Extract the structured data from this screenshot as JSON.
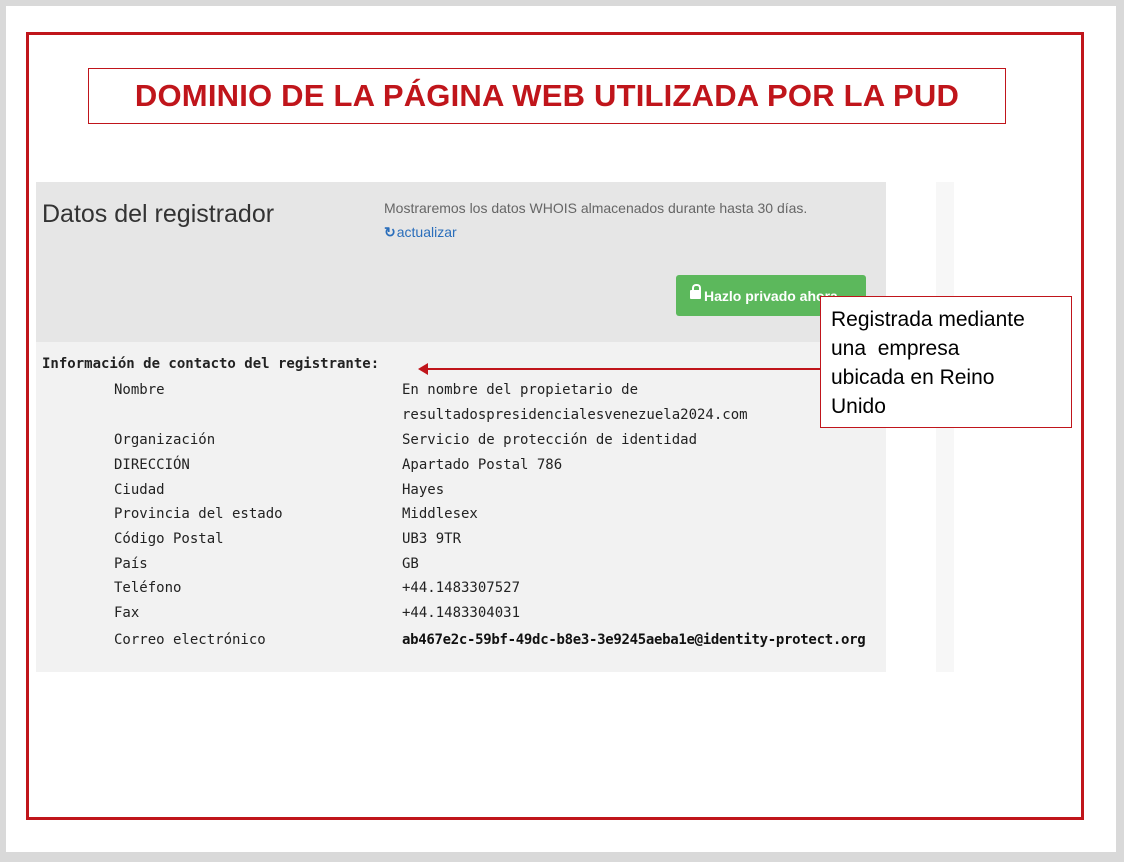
{
  "title": "DOMINIO DE LA PÁGINA WEB UTILIZADA POR LA PUD",
  "header": {
    "heading": "Datos del registrador",
    "note": "Mostraremos los datos WHOIS almacenados durante hasta 30 días.",
    "refresh_label": "actualizar",
    "private_button_label": "Hazlo privado ahora"
  },
  "contact": {
    "section_label": "Información de contacto del registrante:",
    "rows": [
      {
        "label": "Nombre",
        "value": "En nombre del propietario de",
        "value2": "resultadospresidencialesvenezuela2024.com"
      },
      {
        "label": "Organización",
        "value": "Servicio de protección de identidad"
      },
      {
        "label": "DIRECCIÓN",
        "value": "Apartado Postal 786"
      },
      {
        "label": "Ciudad",
        "value": "Hayes"
      },
      {
        "label": "Provincia del estado",
        "value": "Middlesex"
      },
      {
        "label": "Código Postal",
        "value": "UB3 9TR"
      },
      {
        "label": "País",
        "value": "GB"
      },
      {
        "label": "Teléfono",
        "value": "+44.1483307527"
      },
      {
        "label": "Fax",
        "value": "+44.1483304031"
      },
      {
        "label": "Correo electrónico",
        "value": "ab467e2c-59bf-49dc-b8e3-3e9245aeba1e@identity-protect.org"
      }
    ]
  },
  "callout": {
    "lines": [
      "Registrada mediante",
      "una  empresa",
      "ubicada en Reino",
      "Unido"
    ]
  },
  "colors": {
    "accent_red": "#c0151b",
    "button_green": "#5cb85c",
    "link_blue": "#2a6ebb"
  }
}
